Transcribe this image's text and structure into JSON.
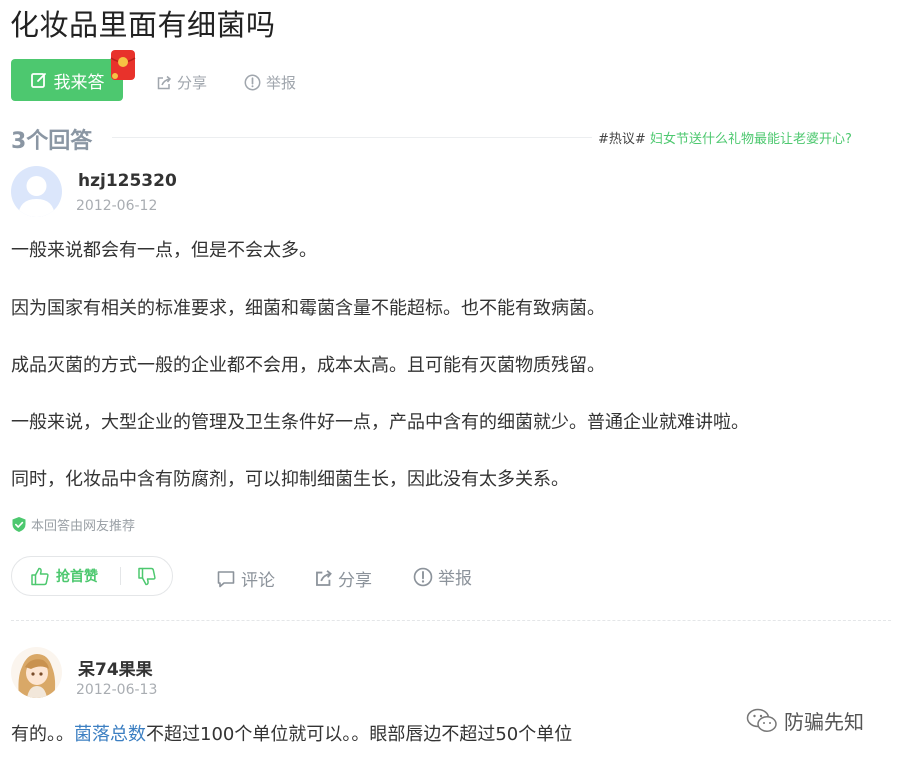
{
  "question": {
    "title": "化妆品里面有细菌吗"
  },
  "toolbar": {
    "answer_label": "我来答",
    "share_label": "分享",
    "report_label": "举报"
  },
  "answers_header": {
    "count_label": "3个回答",
    "hot_tag": "#热议#",
    "hot_topic": "妇女节送什么礼物最能让老婆开心?"
  },
  "answers": [
    {
      "username": "hzj125320",
      "date": "2012-06-12",
      "paragraphs": [
        "一般来说都会有一点，但是不会太多。",
        "因为国家有相关的标准要求，细菌和霉菌含量不能超标。也不能有致病菌。",
        "成品灭菌的方式一般的企业都不会用，成本太高。且可能有灭菌物质残留。",
        "一般来说，大型企业的管理及卫生条件好一点，产品中含有的细菌就少。普通企业就难讲啦。",
        "同时，化妆品中含有防腐剂，可以抑制细菌生长，因此没有太多关系。"
      ],
      "recommend_label": "本回答由网友推荐",
      "upvote_label": "抢首赞",
      "comment_label": "评论",
      "share_label": "分享",
      "report_label": "举报"
    },
    {
      "username": "呆74果果",
      "date": "2012-06-13",
      "text_before": "有的。。",
      "link_text": "菌落总数",
      "text_after": "不超过100个单位就可以。。眼部唇边不超过50个单位"
    }
  ],
  "watermark": {
    "text": "防骗先知"
  },
  "colors": {
    "brand_green": "#4dc86f",
    "link_blue": "#3c7fc2",
    "muted_gray": "#a0a6ad"
  },
  "icons": [
    "edit-icon",
    "red-packet-icon",
    "share-icon",
    "report-icon",
    "avatar",
    "shield-check-icon",
    "thumb-up-icon",
    "thumb-down-icon",
    "comment-icon",
    "wechat-icon"
  ]
}
